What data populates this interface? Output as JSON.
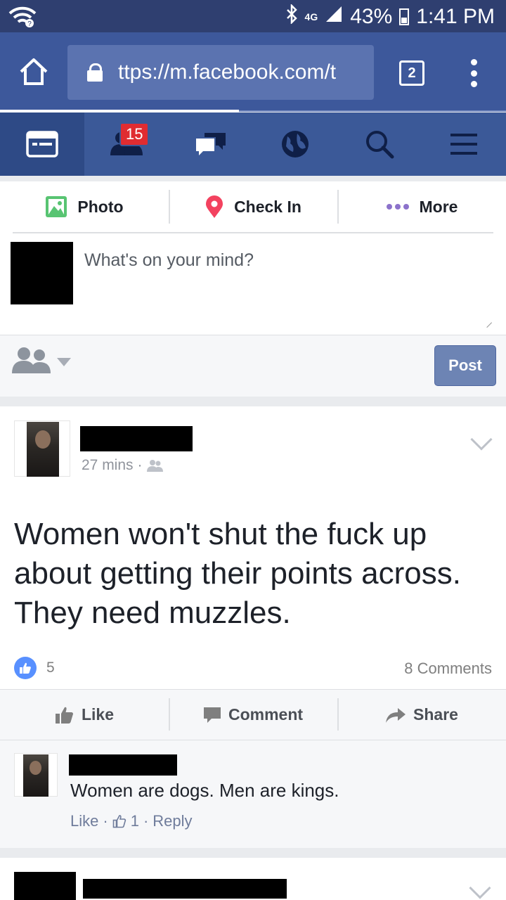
{
  "status_bar": {
    "network": "4G",
    "battery": "43%",
    "time": "1:41 PM"
  },
  "browser": {
    "url": "ttps://m.facebook.com/t",
    "tab_count": "2"
  },
  "nav": {
    "notifications_badge": "15"
  },
  "composer": {
    "photo_label": "Photo",
    "checkin_label": "Check In",
    "more_label": "More",
    "placeholder": "What's on your mind?",
    "post_label": "Post"
  },
  "story": {
    "time": "27 mins",
    "separator": "·",
    "text": "Women won't shut the fuck up about getting their points across. They need muzzles.",
    "like_count": "5",
    "comment_count": "8 Comments",
    "like_label": "Like",
    "comment_label": "Comment",
    "share_label": "Share"
  },
  "comment": {
    "text": "Women are dogs. Men are kings.",
    "like_label": "Like",
    "likes": "1",
    "reply_label": "Reply"
  },
  "colors": {
    "fb_blue": "#3b5998",
    "status_bar": "#2f3f70",
    "browser_bar": "#3d589b"
  }
}
